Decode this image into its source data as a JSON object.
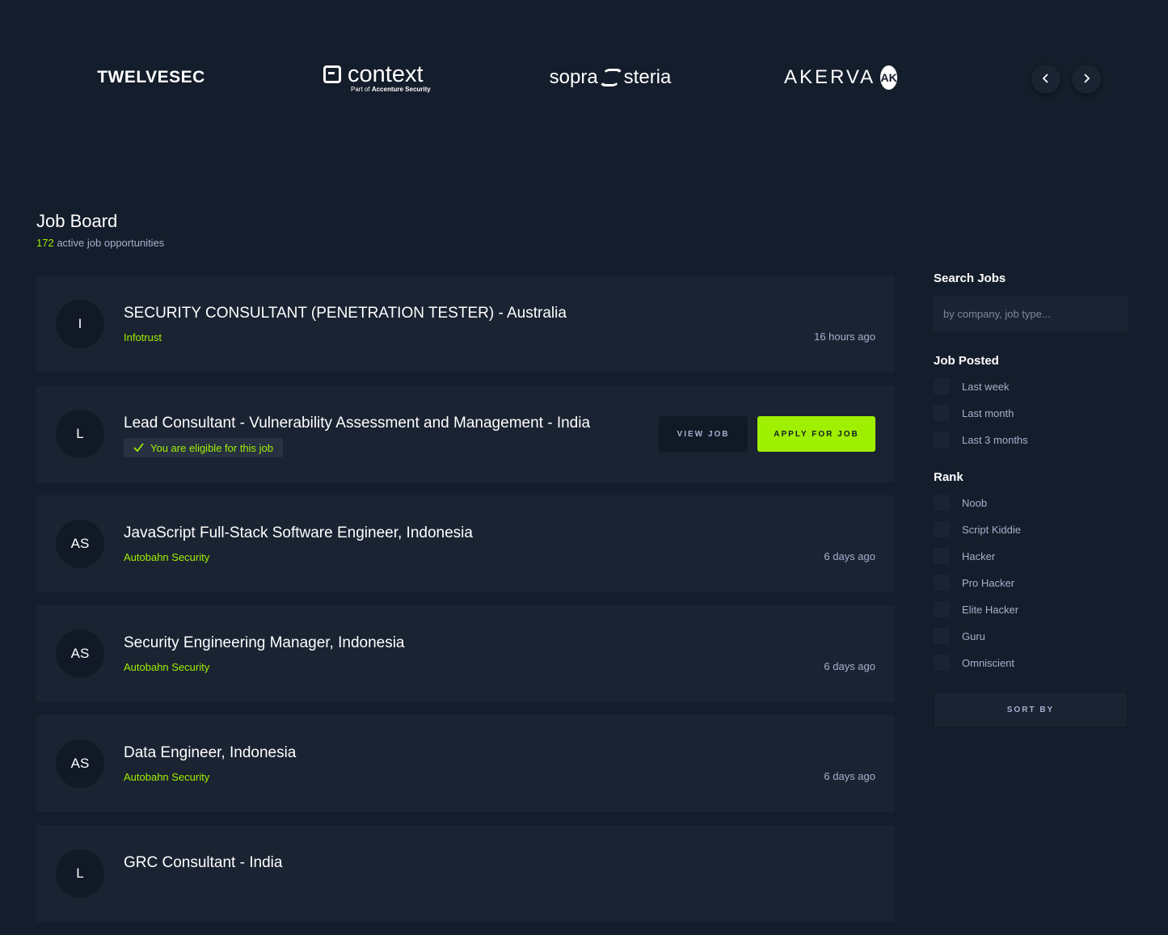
{
  "partners": {
    "logos": [
      {
        "name": "TWELVESEC"
      },
      {
        "name": "context",
        "sub_prefix": "Part of",
        "sub_brand": "Accenture Security"
      },
      {
        "name_left": "sopra",
        "name_right": "steria"
      },
      {
        "name": "AKERVA",
        "mark": "AK"
      }
    ],
    "prev_icon": "‹",
    "next_icon": "›"
  },
  "board": {
    "title": "Job Board",
    "count": "172",
    "count_suffix": "active job opportunities"
  },
  "jobs": [
    {
      "initials": "I",
      "title": "SECURITY CONSULTANT (PENETRATION TESTER) - Australia",
      "company": "Infotrust",
      "posted": "16 hours ago"
    },
    {
      "initials": "L",
      "title": "Lead Consultant - Vulnerability Assessment and Management - India",
      "eligible_text": "You are eligible for this job",
      "view_label": "VIEW JOB",
      "apply_label": "APPLY FOR JOB"
    },
    {
      "initials": "AS",
      "title": "JavaScript Full-Stack Software Engineer, Indonesia",
      "company": "Autobahn Security",
      "posted": "6 days ago"
    },
    {
      "initials": "AS",
      "title": "Security Engineering Manager, Indonesia",
      "company": "Autobahn Security",
      "posted": "6 days ago"
    },
    {
      "initials": "AS",
      "title": "Data Engineer, Indonesia",
      "company": "Autobahn Security",
      "posted": "6 days ago"
    },
    {
      "initials": "L",
      "title": "GRC Consultant - India",
      "company": "",
      "posted": ""
    }
  ],
  "sidebar": {
    "search_heading": "Search Jobs",
    "search_placeholder": "by company, job type...",
    "job_posted_heading": "Job Posted",
    "job_posted_options": [
      "Last week",
      "Last month",
      "Last 3 months"
    ],
    "rank_heading": "Rank",
    "rank_options": [
      "Noob",
      "Script Kiddie",
      "Hacker",
      "Pro Hacker",
      "Elite Hacker",
      "Guru",
      "Omniscient"
    ],
    "sort_label": "SORT BY"
  },
  "colors": {
    "background": "#141d2b",
    "card": "#1a2332",
    "accent": "#9fef00",
    "muted_text": "#a4b1cd"
  }
}
